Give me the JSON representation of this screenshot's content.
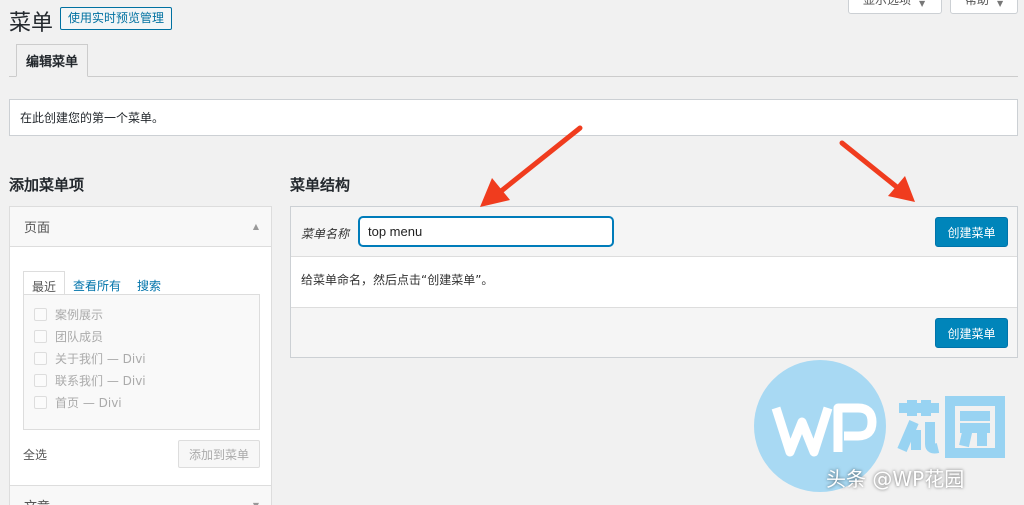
{
  "top": {
    "screen_options": "显示选项",
    "help": "帮助"
  },
  "header": {
    "title": "菜单",
    "live_preview": "使用实时预览管理"
  },
  "tabs": [
    {
      "label": "编辑菜单"
    }
  ],
  "notice": "在此创建您的第一个菜单。",
  "sidebar": {
    "heading": "添加菜单项",
    "pages_label": "页面",
    "inner_tabs": [
      "最近",
      "查看所有",
      "搜索"
    ],
    "items": [
      "案例展示",
      "团队成员",
      "关于我们 — Divi",
      "联系我们 — Divi",
      "首页 — Divi"
    ],
    "select_all": "全选",
    "add_to_menu": "添加到菜单",
    "posts_label": "文章"
  },
  "structure": {
    "heading": "菜单结构",
    "name_label": "菜单名称",
    "name_value": "top menu",
    "create_button": "创建菜单",
    "hint": "给菜单命名，然后点击“创建菜单”。"
  },
  "watermark": {
    "logo": "WP花园",
    "caption": "头条 @WP花园"
  },
  "colors": {
    "primary": "#0085ba",
    "arrow": "#f03c1e",
    "link": "#0073aa"
  }
}
